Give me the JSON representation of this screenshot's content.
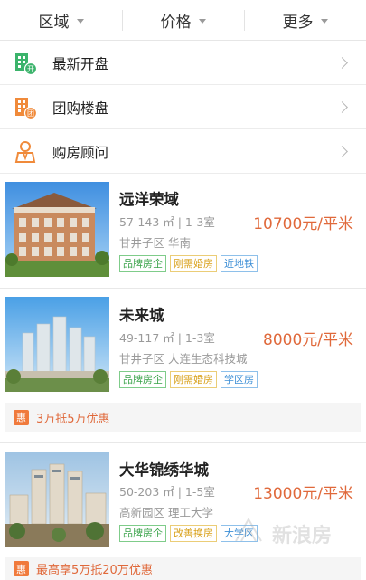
{
  "filters": [
    "区域",
    "价格",
    "更多"
  ],
  "menu": [
    {
      "label": "最新开盘",
      "icon": "new-opening-icon",
      "badge": "开"
    },
    {
      "label": "团购楼盘",
      "icon": "group-buy-icon",
      "badge": "团"
    },
    {
      "label": "购房顾问",
      "icon": "advisor-icon"
    }
  ],
  "listings": [
    {
      "name": "远洋荣域",
      "meta": "57-143 ㎡ | 1-3室",
      "location": "甘井子区 华南",
      "price": "10700元/平米",
      "tags": [
        "品牌房企",
        "刚需婚房",
        "近地铁"
      ]
    },
    {
      "name": "未来城",
      "meta": "49-117 ㎡ | 1-3室",
      "location": "甘井子区 大连生态科技城",
      "price": "8000元/平米",
      "tags": [
        "品牌房企",
        "刚需婚房",
        "学区房"
      ],
      "promo_badge": "惠",
      "promo": "3万抵5万优惠"
    },
    {
      "name": "大华锦绣华城",
      "meta": "50-203 ㎡ | 1-5室",
      "location": "高新园区 理工大学",
      "price": "13000元/平米",
      "tags": [
        "品牌房企",
        "改善换房",
        "大学区"
      ],
      "promo_badge": "惠",
      "promo": "最高享5万抵20万优惠"
    }
  ],
  "colors": {
    "accent": "#e0693b",
    "green_icon": "#3bb36b",
    "orange_icon": "#f08a3a"
  },
  "watermark": "新浪房"
}
